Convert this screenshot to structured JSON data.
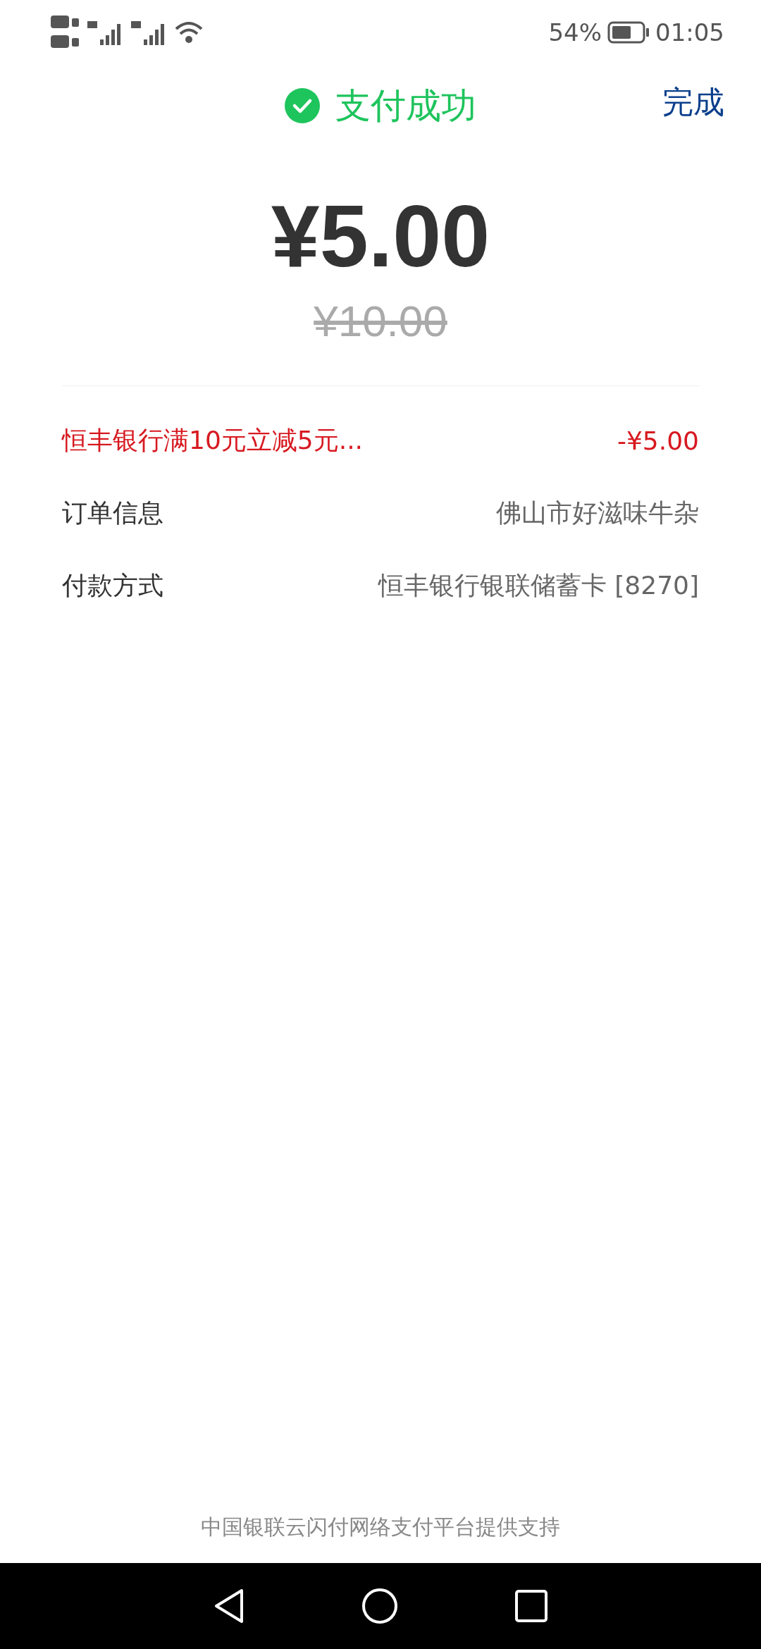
{
  "status_bar": {
    "battery_percent": "54%",
    "time": "01:05"
  },
  "header": {
    "title": "支付成功",
    "done_button": "完成"
  },
  "amount": {
    "paid": "¥5.00",
    "original": "¥10.00"
  },
  "rows": [
    {
      "kind": "discount",
      "label": "恒丰银行满10元立减5元...",
      "value": "-¥5.00"
    },
    {
      "kind": "info",
      "label": "订单信息",
      "value": "佛山市好滋味牛杂"
    },
    {
      "kind": "info",
      "label": "付款方式",
      "value": "恒丰银行银联储蓄卡 [8270]"
    }
  ],
  "footer": "中国银联云闪付网络支付平台提供支持"
}
